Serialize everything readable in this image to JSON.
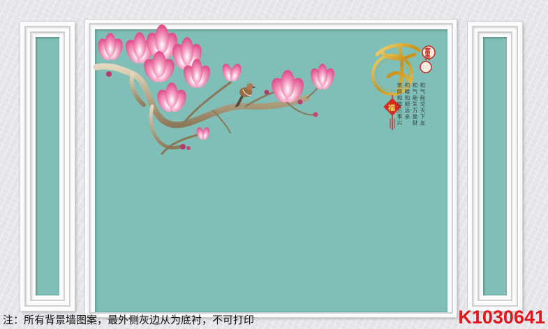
{
  "caption": "注：所有背景墙图案，最外侧灰边从为底衬，不可打印",
  "product_code": "K1030641",
  "ornament": {
    "seal_top": "富贵",
    "seal_bottom": "福"
  },
  "poem": [
    "和气能交天下友",
    "和气能生万里财",
    "和睦和顺远亲",
    "家庭和睦万事兴"
  ],
  "colors": {
    "panel": "#7fbfb8",
    "frame": "#fbfbfb",
    "code": "#e3151a",
    "blossom": "#f07aa8",
    "gold": "#d9a62a"
  },
  "icons": [
    "magnolia-branch-icon",
    "bird-icon",
    "family-calligraphy-logo",
    "lucky-knot-icon"
  ]
}
